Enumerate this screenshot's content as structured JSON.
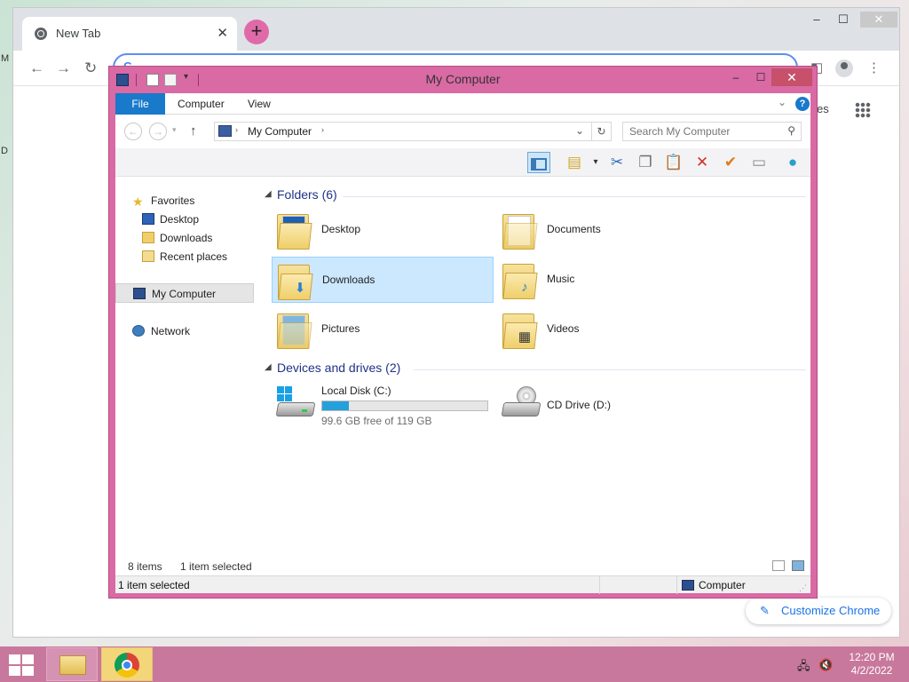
{
  "chrome": {
    "tab_title": "New Tab",
    "tab_close": "✕",
    "new_tab": "+",
    "omnibox_value": "",
    "omnibox_g": "G",
    "ntp_links_fragment": "es",
    "customize_label": "Customize Chrome",
    "edge_letters": [
      "M",
      "D"
    ],
    "window_controls": {
      "minimize": "–",
      "maximize": "☐",
      "close": "✕"
    }
  },
  "explorer": {
    "title": "My Computer",
    "window_controls": {
      "minimize": "–",
      "maximize": "☐",
      "close": "✕"
    },
    "ribbon": {
      "file": "File",
      "tabs": [
        "Computer",
        "View"
      ],
      "help": "?"
    },
    "address": {
      "path": "My Computer",
      "search_placeholder": "Search My Computer"
    },
    "nav": {
      "favorites": "Favorites",
      "favorite_items": [
        "Desktop",
        "Downloads",
        "Recent places"
      ],
      "my_computer": "My Computer",
      "network": "Network"
    },
    "folders_header": "Folders (6)",
    "folders": [
      {
        "name": "Desktop",
        "emblem": "desktop"
      },
      {
        "name": "Documents",
        "emblem": "documents"
      },
      {
        "name": "Downloads",
        "emblem": "downloads",
        "selected": true
      },
      {
        "name": "Music",
        "emblem": "music"
      },
      {
        "name": "Pictures",
        "emblem": "pictures"
      },
      {
        "name": "Videos",
        "emblem": "videos"
      }
    ],
    "drives_header": "Devices and drives (2)",
    "drives": [
      {
        "name": "Local Disk (C:)",
        "free_text": "99.6 GB free of 119 GB",
        "used_fraction": 0.163
      },
      {
        "name": "CD Drive (D:)"
      }
    ],
    "status": {
      "item_count": "8 items",
      "selected_inner": "1 item selected",
      "selected_bar": "1 item selected",
      "location": "Computer"
    }
  },
  "taskbar": {
    "time": "12:20 PM",
    "date": "4/2/2022"
  }
}
